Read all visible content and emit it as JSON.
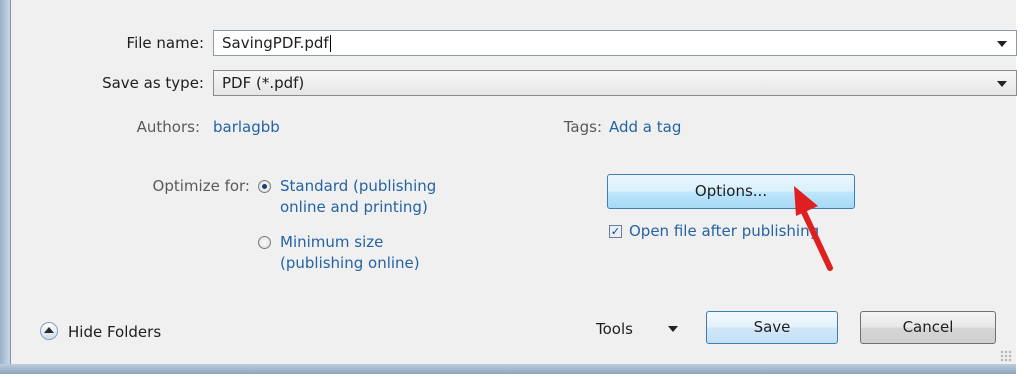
{
  "form": {
    "file_name_label": "File name:",
    "file_name_value": "SavingPDF.pdf",
    "save_type_label": "Save as type:",
    "save_type_value": "PDF (*.pdf)"
  },
  "meta": {
    "authors_label": "Authors:",
    "authors_value": "barlagbb",
    "tags_label": "Tags:",
    "tags_value": "Add a tag"
  },
  "optimize": {
    "label": "Optimize for:",
    "standard_line1": "Standard (publishing",
    "standard_line2": "online and printing)",
    "minimum_line1": "Minimum size",
    "minimum_line2": "(publishing online)",
    "selected": "standard"
  },
  "options": {
    "button_label": "Options...",
    "open_after_label": "Open file after publishing",
    "open_after_checked": true
  },
  "footer": {
    "hide_folders": "Hide Folders",
    "tools": "Tools",
    "save": "Save",
    "cancel": "Cancel"
  },
  "annotation": {
    "arrow_color": "#e02020",
    "arrow_icon": "red-pointer-arrow-icon"
  }
}
